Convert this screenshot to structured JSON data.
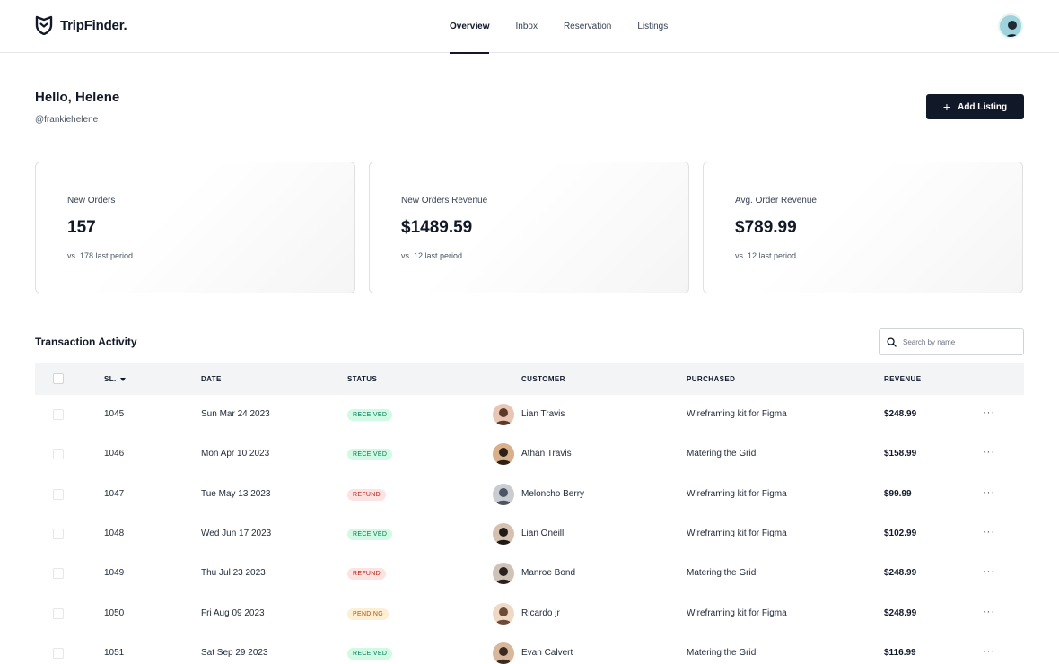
{
  "brand": {
    "name": "TripFinder."
  },
  "nav": [
    {
      "label": "Overview",
      "active": true
    },
    {
      "label": "Inbox",
      "active": false
    },
    {
      "label": "Reservation",
      "active": false
    },
    {
      "label": "Listings",
      "active": false
    }
  ],
  "greeting": {
    "title": "Hello, Helene",
    "handle": "@frankiehelene"
  },
  "actions": {
    "add_listing": "Add Listing"
  },
  "stats": [
    {
      "label": "New Orders",
      "value": "157",
      "sub": "vs. 178 last period"
    },
    {
      "label": "New Orders Revenue",
      "value": "$1489.59",
      "sub": "vs. 12 last period"
    },
    {
      "label": "Avg. Order Revenue",
      "value": "$789.99",
      "sub": "vs. 12 last period"
    }
  ],
  "transactions": {
    "title": "Transaction Activity",
    "search_placeholder": "Search by name",
    "columns": {
      "sl": "SL.",
      "date": "DATE",
      "status": "STATUS",
      "customer": "CUSTOMER",
      "purchased": "PURCHASED",
      "revenue": "REVENUE"
    },
    "rows": [
      {
        "sl": "1045",
        "date": "Sun Mar 24 2023",
        "status": "RECEIVED",
        "customer": "Lian Travis",
        "purchased": "Wireframing kit for Figma",
        "revenue": "$248.99"
      },
      {
        "sl": "1046",
        "date": "Mon Apr 10 2023",
        "status": "RECEIVED",
        "customer": "Athan Travis",
        "purchased": "Matering the Grid",
        "revenue": "$158.99"
      },
      {
        "sl": "1047",
        "date": "Tue May 13 2023",
        "status": "REFUND",
        "customer": "Meloncho Berry",
        "purchased": "Wireframing kit for Figma",
        "revenue": "$99.99"
      },
      {
        "sl": "1048",
        "date": "Wed Jun 17 2023",
        "status": "RECEIVED",
        "customer": "Lian Oneill",
        "purchased": "Wireframing kit for Figma",
        "revenue": "$102.99"
      },
      {
        "sl": "1049",
        "date": "Thu Jul 23 2023",
        "status": "REFUND",
        "customer": "Manroe Bond",
        "purchased": "Matering the Grid",
        "revenue": "$248.99"
      },
      {
        "sl": "1050",
        "date": "Fri Aug 09 2023",
        "status": "PENDING",
        "customer": "Ricardo jr",
        "purchased": "Wireframing kit for Figma",
        "revenue": "$248.99"
      },
      {
        "sl": "1051",
        "date": "Sat Sep 29 2023",
        "status": "RECEIVED",
        "customer": "Evan Calvert",
        "purchased": "Matering the Grid",
        "revenue": "$116.99"
      }
    ]
  },
  "icons": {
    "brand": "shield-logo-icon",
    "search": "search-icon",
    "add": "plus-icon",
    "row_menu": "more-horizontal-icon",
    "sort": "caret-down-icon"
  },
  "colors": {
    "primary": "#111827",
    "received_bg": "#d1fae5",
    "refund_bg": "#fde2e2",
    "pending_bg": "#fdefd3"
  }
}
